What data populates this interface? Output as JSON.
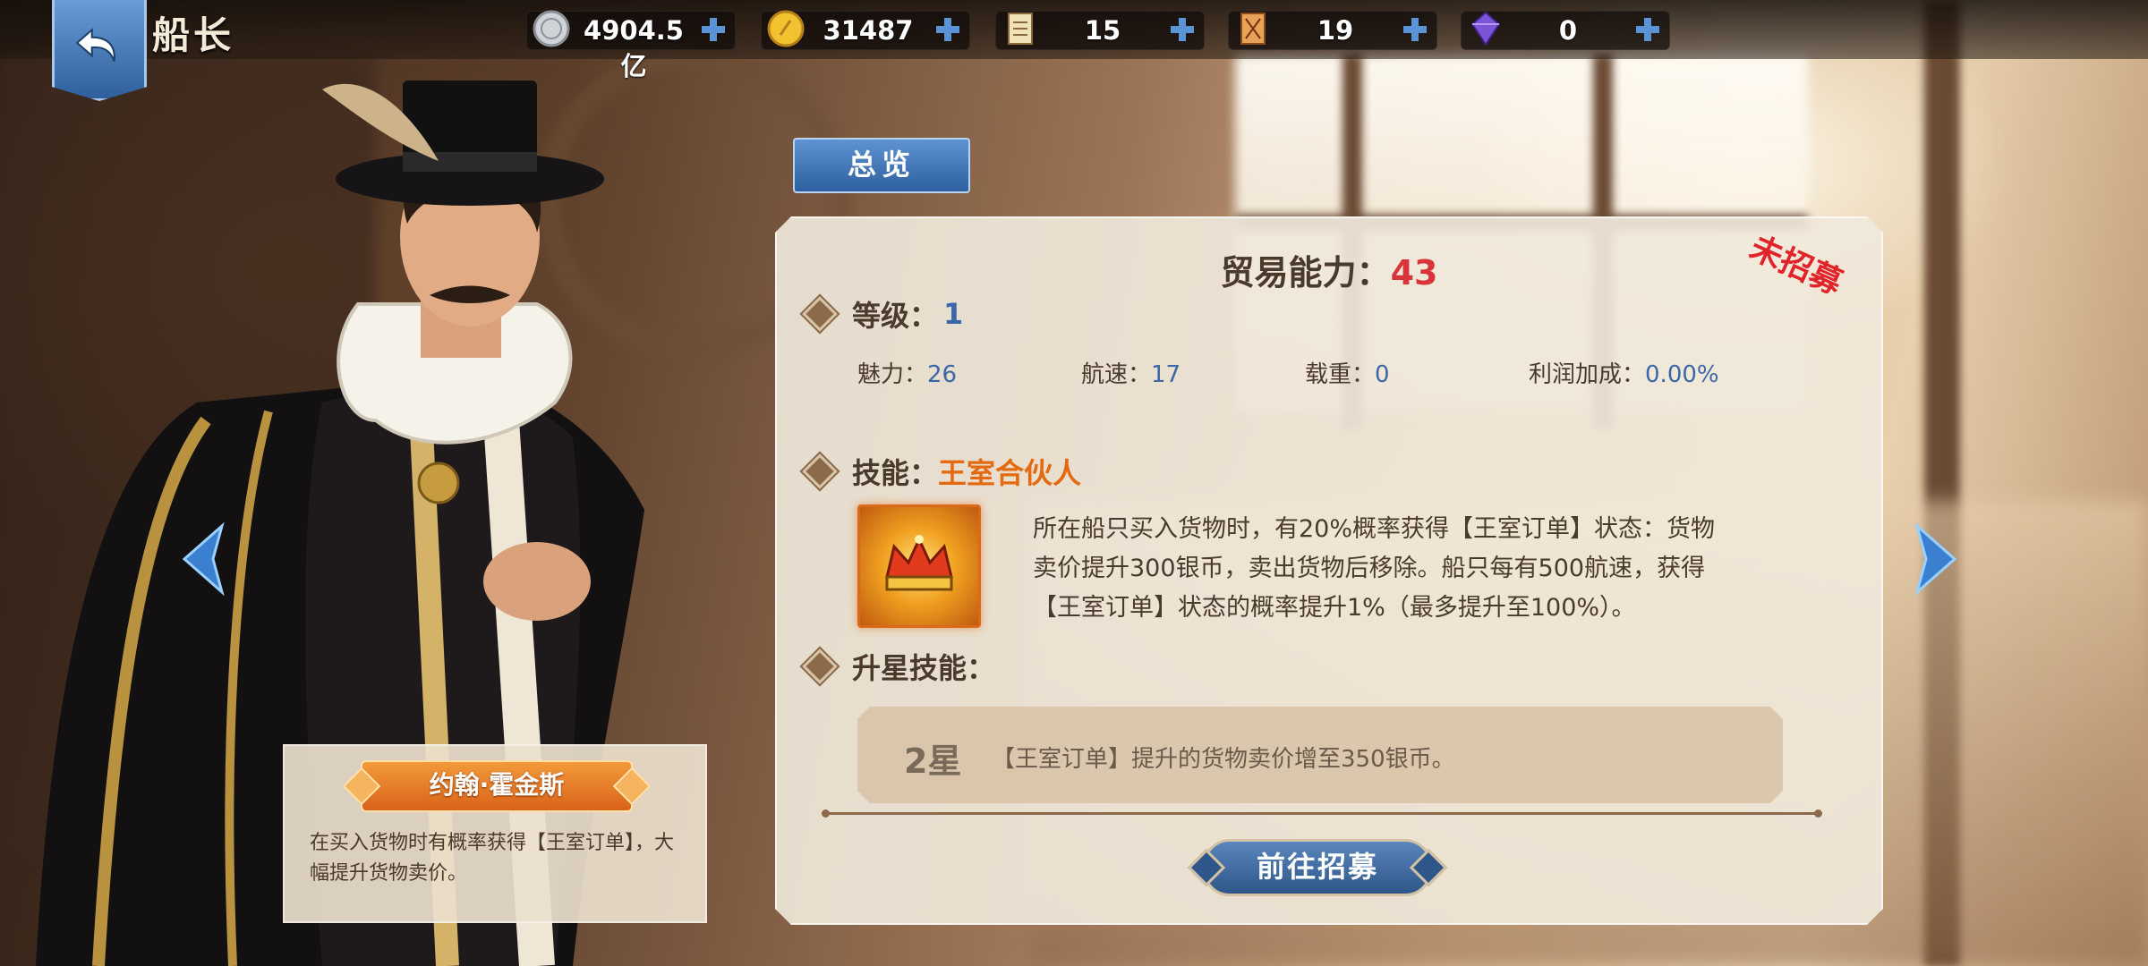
{
  "header": {
    "title": "船长",
    "resources": [
      {
        "icon": "silver-coin-icon",
        "value": "4904.5亿"
      },
      {
        "icon": "gold-coin-icon",
        "value": "31487"
      },
      {
        "icon": "scroll-icon",
        "value": "15"
      },
      {
        "icon": "map-ticket-icon",
        "value": "19"
      },
      {
        "icon": "purple-gem-icon",
        "value": "0"
      }
    ]
  },
  "captain": {
    "name": "约翰·霍金斯",
    "summary": "在买入货物时有概率获得【王室订单】，大幅提升货物卖价。"
  },
  "tabs": {
    "overview": "总览"
  },
  "panel": {
    "trade_label": "贸易能力：",
    "trade_value": "43",
    "status_stamp": "未招募",
    "level_label": "等级：",
    "level_value": "1",
    "stats": [
      {
        "label": "魅力：",
        "value": "26"
      },
      {
        "label": "航速：",
        "value": "17"
      },
      {
        "label": "载重：",
        "value": "0"
      },
      {
        "label": "利润加成：",
        "value": "0.00%"
      }
    ],
    "skill_label": "技能：",
    "skill_name": "王室合伙人",
    "skill_desc_lines": [
      "所在船只买入货物时，有20%概率获得【王室订单】状态：货物",
      "卖价提升300银币，卖出货物后移除。船只每有500航速，获得",
      "【王室订单】状态的概率提升1%（最多提升至100%）。"
    ],
    "star_skill_label": "升星技能：",
    "star_level": "2星",
    "star_desc": "【王室订单】提升的货物卖价增至350银币。",
    "recruit_button": "前往招募"
  },
  "colors": {
    "accent_blue": "#2e609f",
    "highlight_red": "#d9343a",
    "skill_orange": "#e46a12",
    "panel_bg": "#f0e8da"
  }
}
